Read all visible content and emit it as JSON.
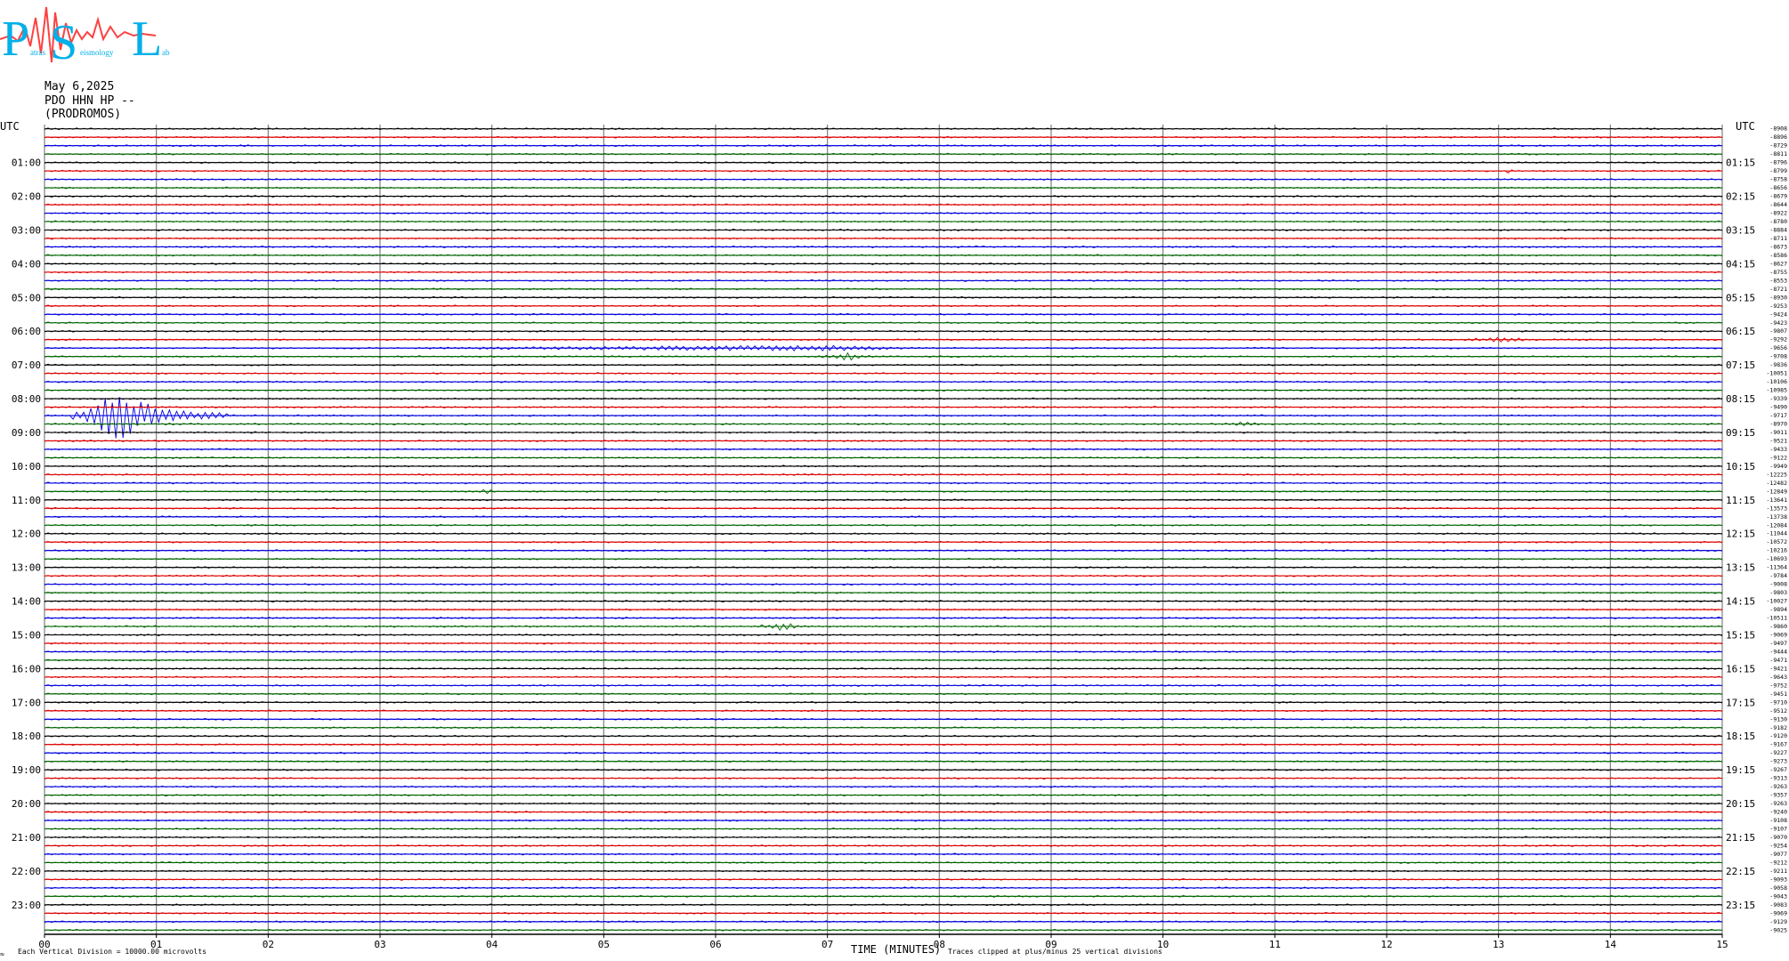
{
  "logo": {
    "letters": [
      "P",
      "S",
      "L"
    ],
    "words": [
      "atras",
      "eismology",
      "ab"
    ]
  },
  "header": {
    "date": "May 6,2025",
    "station": "PDO HHN HP --",
    "location": "(PRODROMOS)"
  },
  "footer": {
    "scale_note": "Each Vertical Division = 10000.00 microvolts",
    "clip_note": "Traces clipped at plus/minus 25 vertical divisions",
    "corner_mark": "≈"
  },
  "colors": {
    "trace_cycle": [
      "#000000",
      "#dd0000",
      "#0000dd",
      "#006400"
    ],
    "grid_vertical": "#808080",
    "logo_red": "#ff4040",
    "logo_cyan": "#00b0e8"
  },
  "chart_data": {
    "type": "helicorder",
    "xlabel": "TIME (MINUTES)",
    "x_range_minutes": [
      0,
      15
    ],
    "x_ticks": [
      "00",
      "01",
      "02",
      "03",
      "04",
      "05",
      "06",
      "07",
      "08",
      "09",
      "10",
      "11",
      "12",
      "13",
      "14",
      "15"
    ],
    "left_axis_title": "UTC",
    "right_axis_title": "UTC",
    "left_hour_labels": [
      "01:00",
      "02:00",
      "03:00",
      "04:00",
      "05:00",
      "06:00",
      "07:00",
      "08:00",
      "09:00",
      "10:00",
      "11:00",
      "12:00",
      "13:00",
      "14:00",
      "15:00",
      "16:00",
      "17:00",
      "18:00",
      "19:00",
      "20:00",
      "21:00",
      "22:00",
      "23:00"
    ],
    "right_hour_labels": [
      "01:15",
      "02:15",
      "03:15",
      "04:15",
      "05:15",
      "06:15",
      "07:15",
      "08:15",
      "09:15",
      "10:15",
      "11:15",
      "12:15",
      "13:15",
      "14:15",
      "15:15",
      "16:15",
      "17:15",
      "18:15",
      "19:15",
      "20:15",
      "21:15",
      "22:15",
      "23:15"
    ],
    "row_count": 96,
    "row_minutes": 15,
    "row_offsets": [
      "-8908",
      "-8896",
      "-8729",
      "-8811",
      "-8796",
      "-8799",
      "-8758",
      "-8656",
      "-8679",
      "-8644",
      "-8922",
      "-8780",
      "-8884",
      "-8711",
      "-8673",
      "-8586",
      "-8627",
      "-8755",
      "-8553",
      "-8721",
      "-8930",
      "-9253",
      "-9424",
      "-9423",
      "-9807",
      "-9292",
      "-9656",
      "-9708",
      "-9836",
      "-10051",
      "-10106",
      "-10985",
      "-9339",
      "-9490",
      "-9717",
      "-8970",
      "-9011",
      "-9521",
      "-9433",
      "-9122",
      "-9949",
      "-12225",
      "-12482",
      "-12849",
      "-13641",
      "-13573",
      "-13738",
      "-12084",
      "-11044",
      "-10572",
      "-10216",
      "-10693",
      "-11364",
      "-9784",
      "-9008",
      "-9803",
      "-10027",
      "-9894",
      "-10511",
      "-9860",
      "-9069",
      "-9497",
      "-9444",
      "-9471",
      "-9421",
      "-9643",
      "-9752",
      "-9451",
      "-9710",
      "-9512",
      "-9130",
      "-9182",
      "-9120",
      "-9167",
      "-9227",
      "-9273",
      "-9267",
      "-9313",
      "-9263",
      "-9357",
      "-9263",
      "-9240",
      "-9108",
      "-9107",
      "-9070",
      "-9254",
      "-9077",
      "-9212",
      "-9211",
      "-9093",
      "-9058",
      "-9043",
      "-9083",
      "-9069",
      "-9129",
      "-9025"
    ],
    "events": [
      {
        "row": 34,
        "start_min": 0.25,
        "end_min": 1.65,
        "peak_min": 0.65,
        "amplitude_div": 3.2
      },
      {
        "row": 26,
        "start_min": 2.0,
        "end_min": 8.9,
        "peak_min": 7.0,
        "amplitude_div": 0.35
      },
      {
        "row": 27,
        "start_min": 6.8,
        "end_min": 7.6,
        "peak_min": 7.2,
        "amplitude_div": 0.45
      },
      {
        "row": 25,
        "start_min": 12.5,
        "end_min": 14.0,
        "peak_min": 13.0,
        "amplitude_div": 0.3
      },
      {
        "row": 43,
        "start_min": 3.85,
        "end_min": 4.1,
        "peak_min": 3.95,
        "amplitude_div": 0.45
      },
      {
        "row": 59,
        "start_min": 6.3,
        "end_min": 7.0,
        "peak_min": 6.6,
        "amplitude_div": 0.55
      },
      {
        "row": 35,
        "start_min": 10.5,
        "end_min": 11.1,
        "peak_min": 10.7,
        "amplitude_div": 0.35
      },
      {
        "row": 35,
        "start_min": 1.0,
        "end_min": 1.3,
        "peak_min": 1.1,
        "amplitude_div": 0.25
      },
      {
        "row": 2,
        "start_min": 1.7,
        "end_min": 1.95,
        "peak_min": 1.8,
        "amplitude_div": 0.3
      },
      {
        "row": 5,
        "start_min": 13.05,
        "end_min": 13.15,
        "peak_min": 13.1,
        "amplitude_div": 0.35
      }
    ]
  }
}
